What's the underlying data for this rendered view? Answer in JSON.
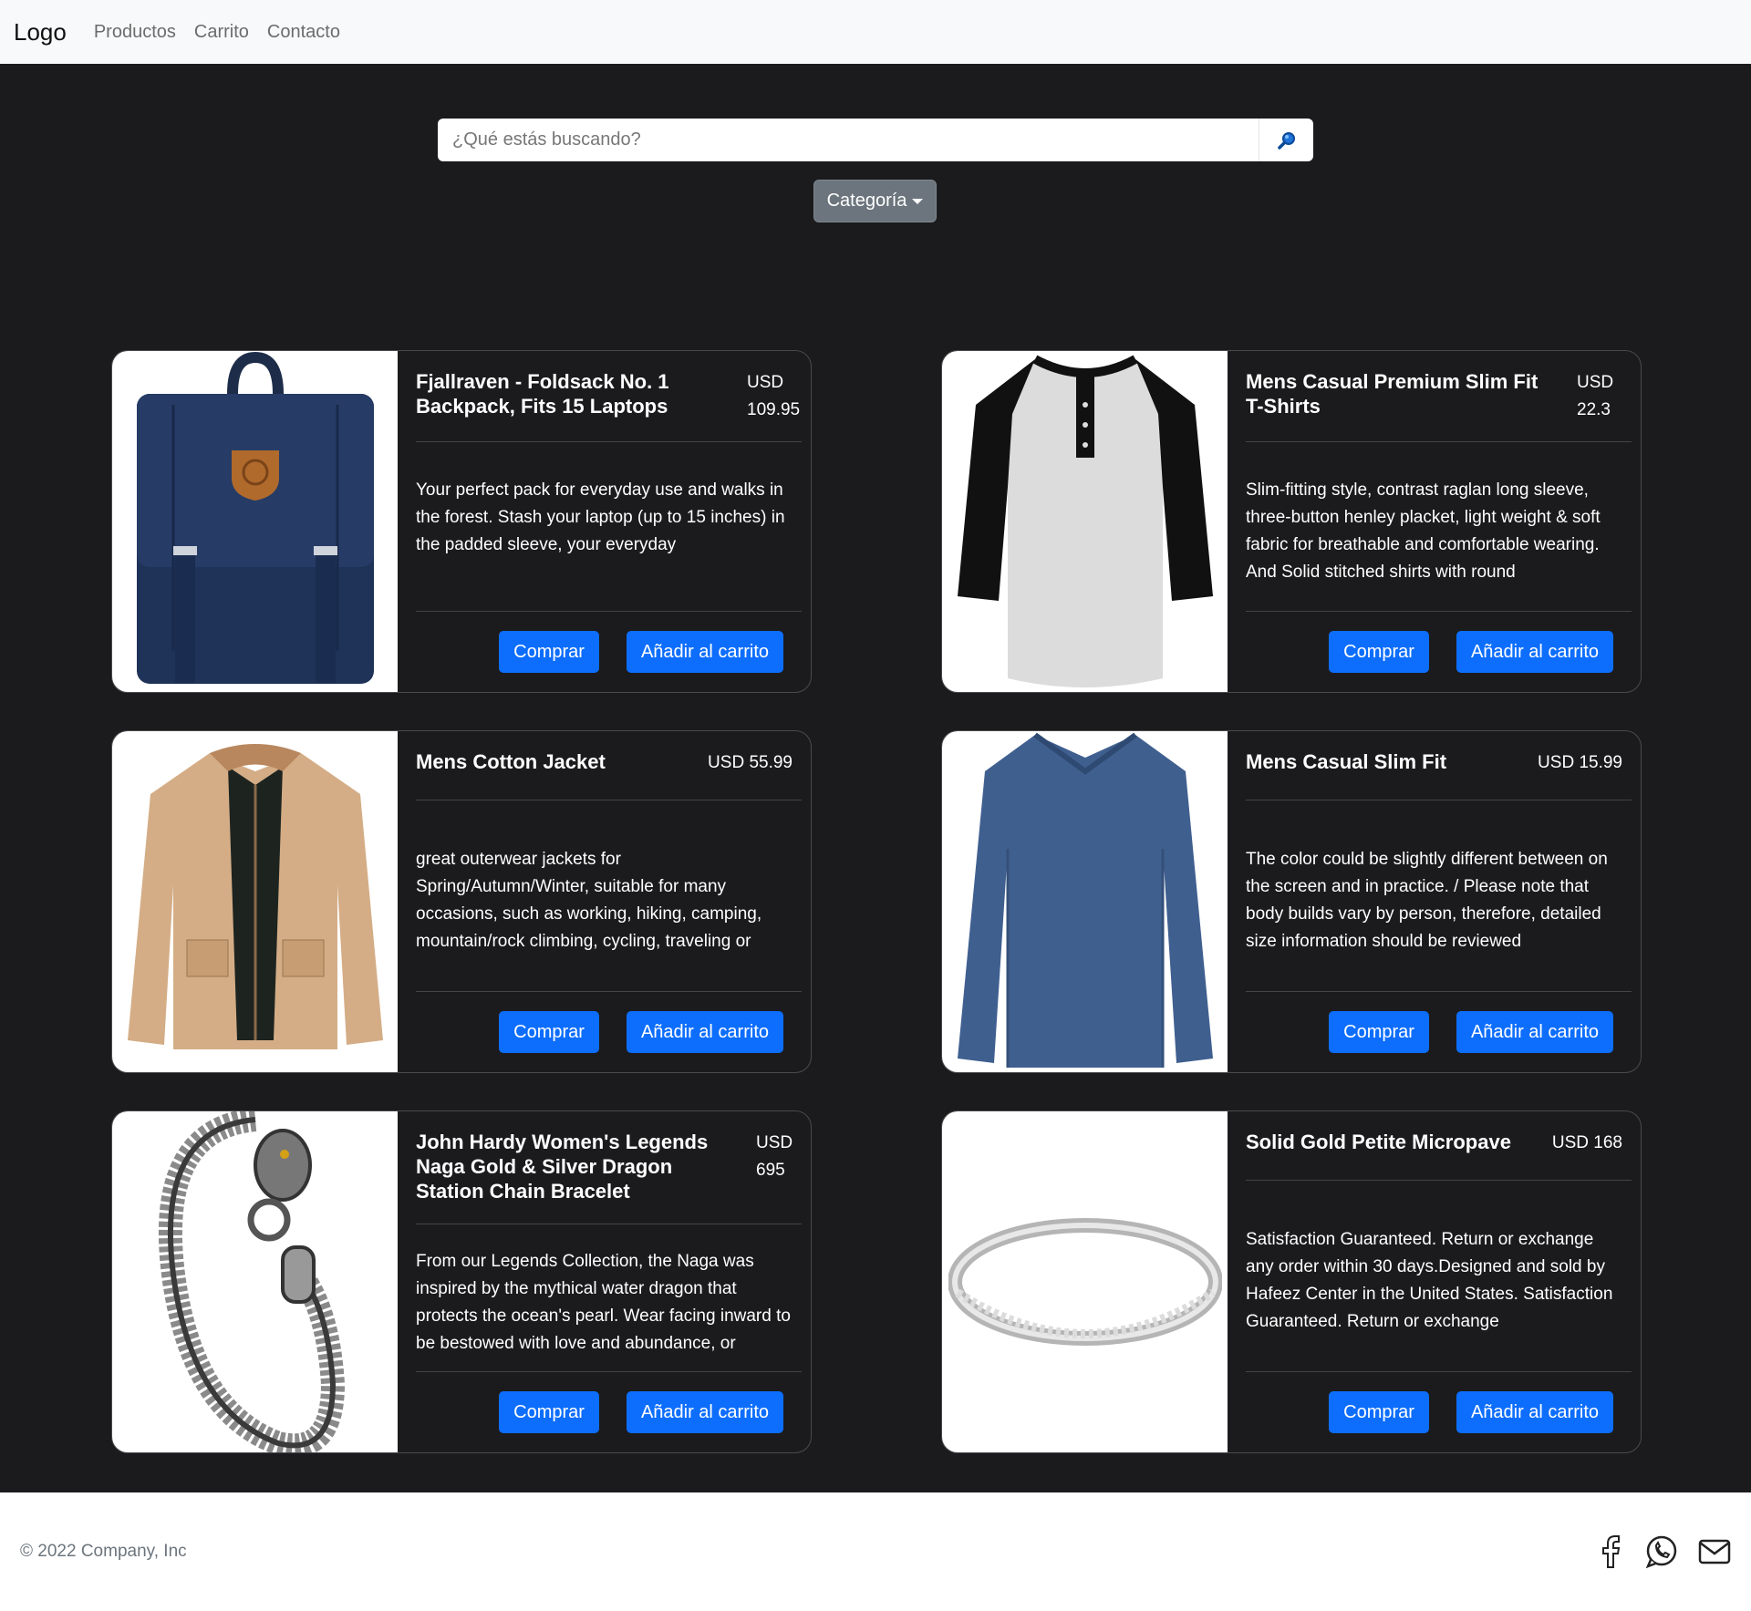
{
  "nav": {
    "brand": "Logo",
    "links": [
      "Productos",
      "Carrito",
      "Contacto"
    ]
  },
  "search": {
    "placeholder": "¿Qué estás buscando?",
    "icon": "search-icon",
    "category_label": "Categoría"
  },
  "products": [
    {
      "title": "Fjallraven - Foldsack No. 1 Backpack, Fits 15 Laptops",
      "price": "USD 109.95",
      "description": "Your perfect pack for everyday use and walks in the forest. Stash your laptop (up to 15 inches) in the padded sleeve, your everyday",
      "image": "backpack"
    },
    {
      "title": "Mens Casual Premium Slim Fit T-Shirts",
      "price": "USD 22.3",
      "description": "Slim-fitting style, contrast raglan long sleeve, three-button henley placket, light weight & soft fabric for breathable and comfortable wearing. And Solid stitched shirts with round",
      "image": "henley-shirt"
    },
    {
      "title": "Mens Cotton Jacket",
      "price": "USD 55.99",
      "description": "great outerwear jackets for Spring/Autumn/Winter, suitable for many occasions, such as working, hiking, camping, mountain/rock climbing, cycling, traveling or",
      "image": "jacket"
    },
    {
      "title": "Mens Casual Slim Fit",
      "price": "USD 15.99",
      "description": "The color could be slightly different between on the screen and in practice. / Please note that body builds vary by person, therefore, detailed size information should be reviewed",
      "image": "long-sleeve-shirt"
    },
    {
      "title": "John Hardy Women's Legends Naga Gold & Silver Dragon Station Chain Bracelet",
      "price": "USD 695",
      "description": "From our Legends Collection, the Naga was inspired by the mythical water dragon that protects the ocean's pearl. Wear facing inward to be bestowed with love and abundance, or",
      "image": "bracelet"
    },
    {
      "title": "Solid Gold Petite Micropave",
      "price": "USD 168",
      "description": "Satisfaction Guaranteed. Return or exchange any order within 30 days.Designed and sold by Hafeez Center in the United States. Satisfaction Guaranteed. Return or exchange",
      "image": "ring"
    }
  ],
  "buttons": {
    "buy": "Comprar",
    "add_to_cart": "Añadir al carrito"
  },
  "footer": {
    "copyright": "© 2022 Company, Inc",
    "socials": [
      "facebook-icon",
      "whatsapp-icon",
      "mail-icon"
    ]
  },
  "colors": {
    "background": "#1b1b1d",
    "primary": "#0d6efd",
    "secondary": "#6c757d",
    "navbar": "#f8f9fa"
  }
}
